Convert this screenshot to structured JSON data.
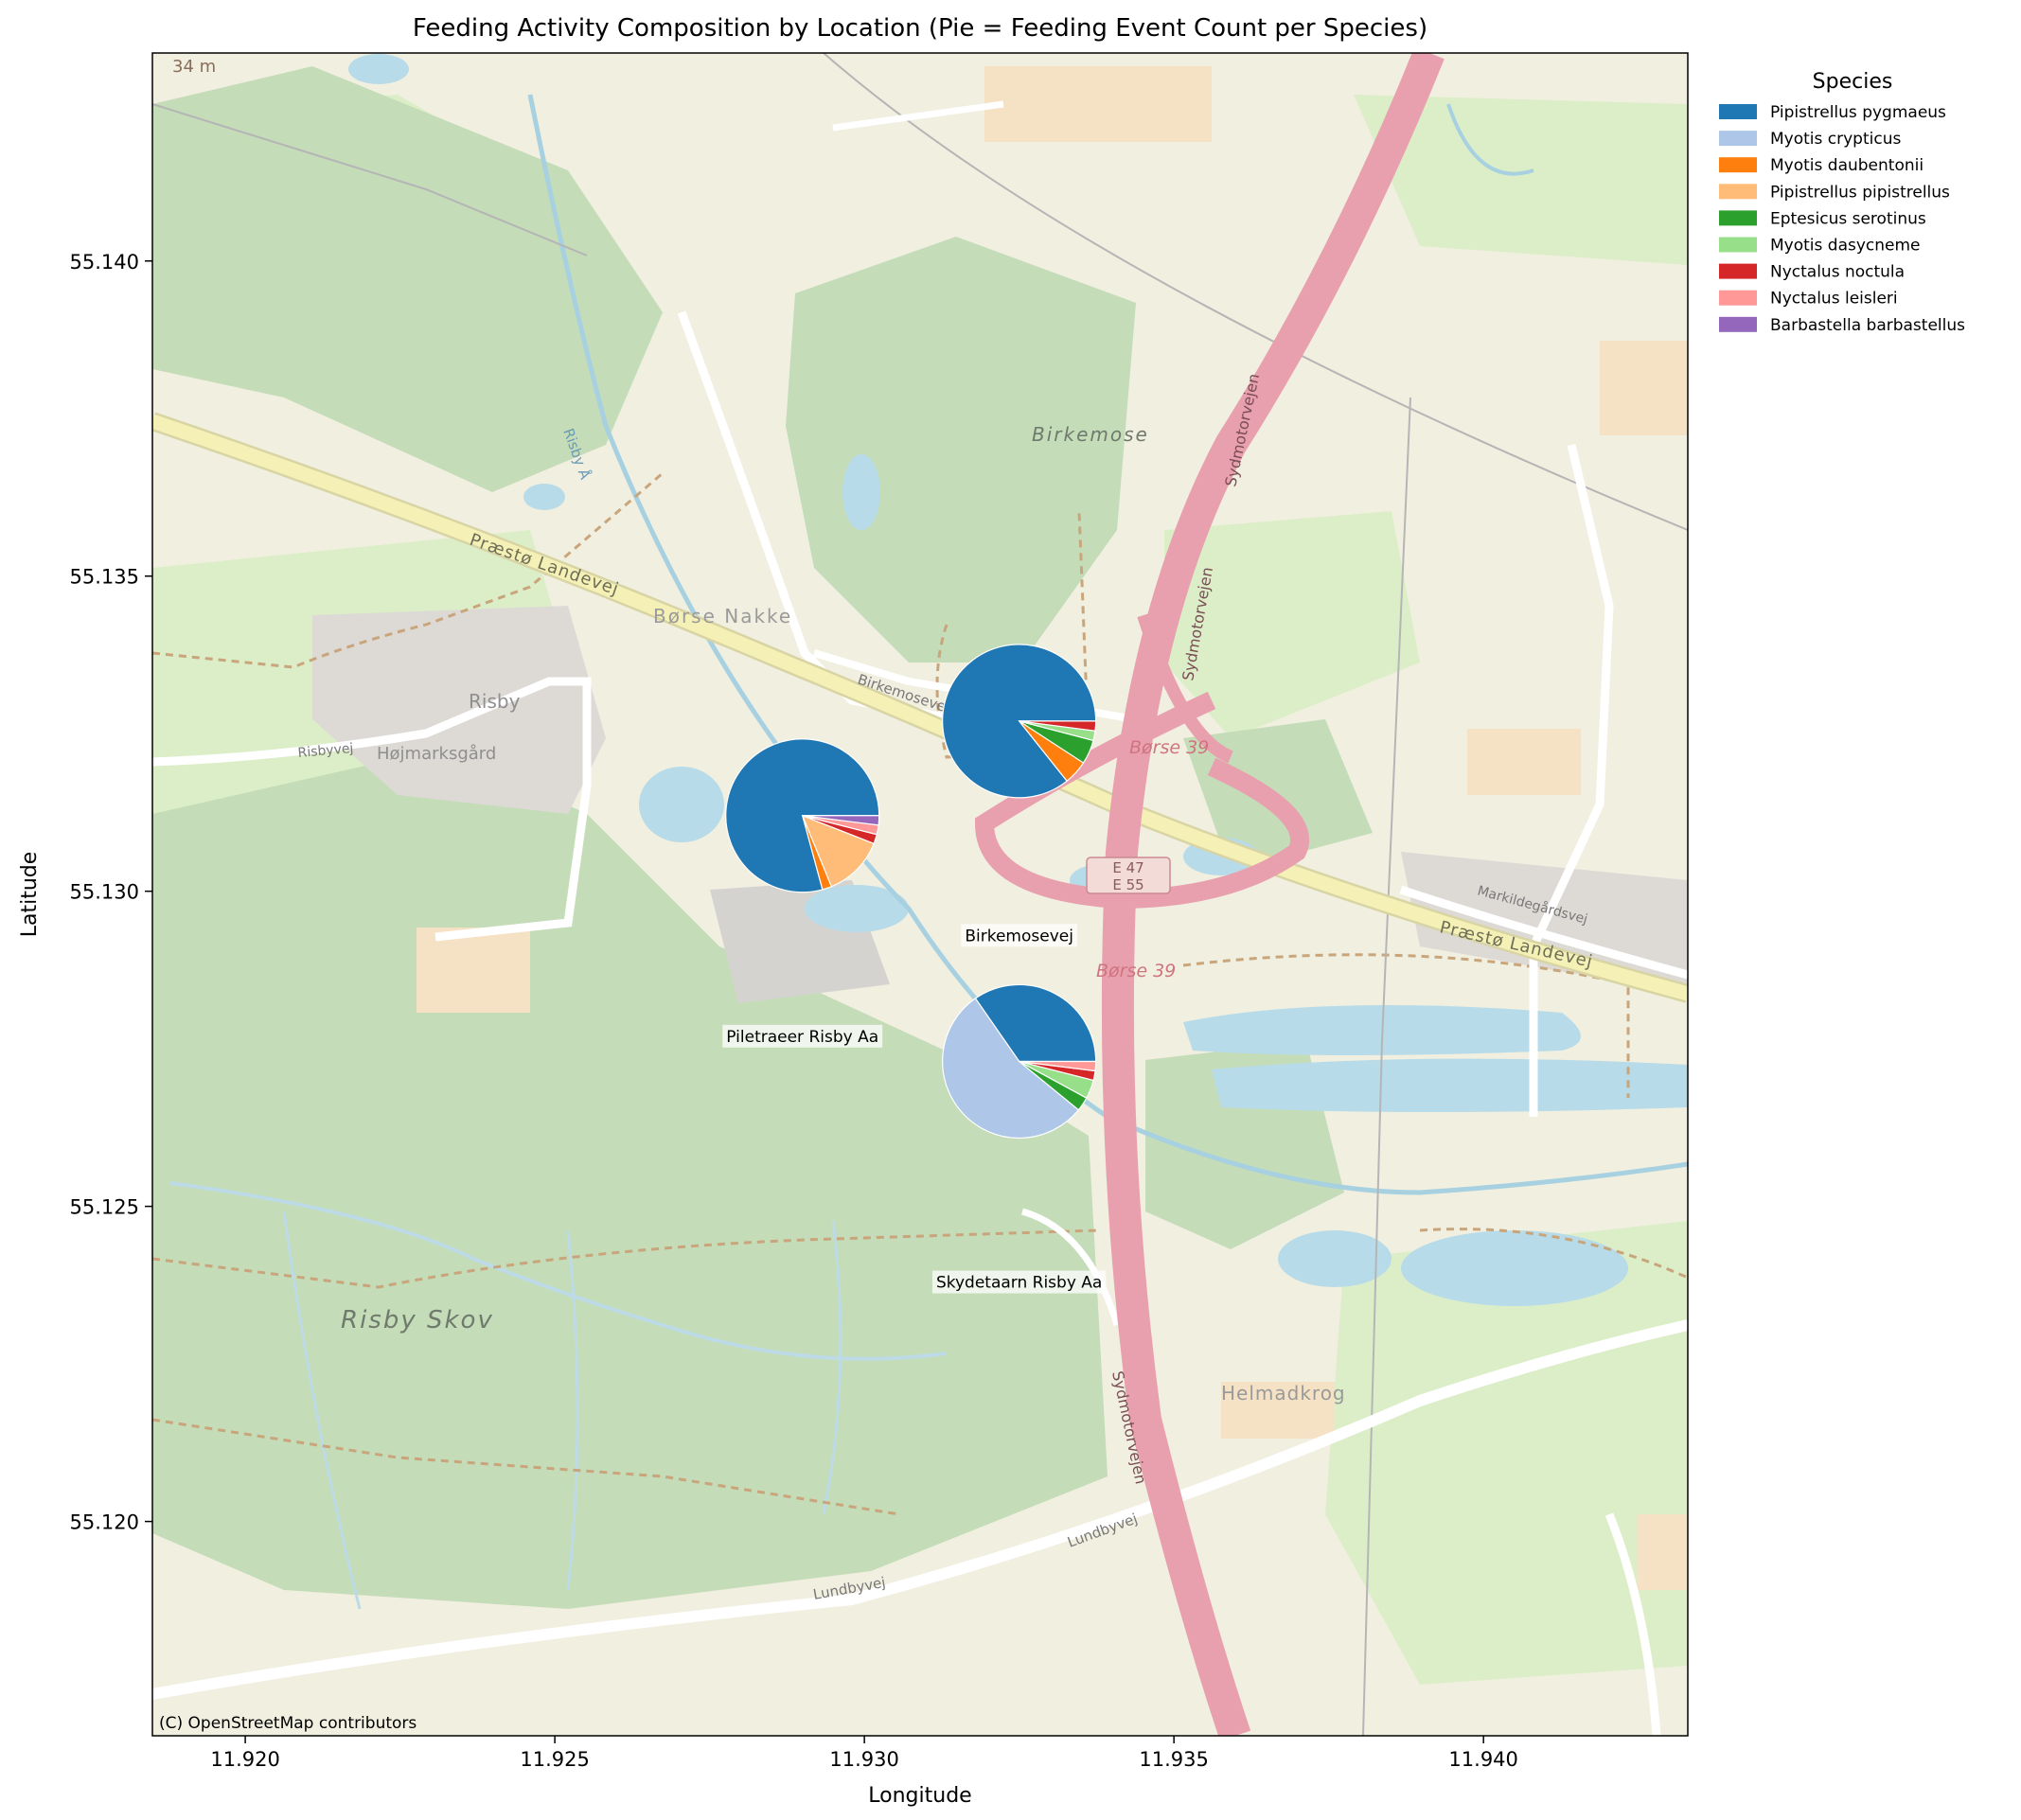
{
  "title": "Feeding Activity Composition by Location (Pie = Feeding Event Count per Species)",
  "xlabel": "Longitude",
  "ylabel": "Latitude",
  "attribution": "(C) OpenStreetMap contributors",
  "legend": {
    "title": "Species",
    "placement": "outside-right",
    "items": [
      {
        "label": "Pipistrellus pygmaeus",
        "color": "#1f77b4"
      },
      {
        "label": "Myotis crypticus",
        "color": "#aec7e8"
      },
      {
        "label": "Myotis daubentonii",
        "color": "#ff7f0e"
      },
      {
        "label": "Pipistrellus pipistrellus",
        "color": "#ffbb78"
      },
      {
        "label": "Eptesicus serotinus",
        "color": "#2ca02c"
      },
      {
        "label": "Myotis dasycneme",
        "color": "#98df8a"
      },
      {
        "label": "Nyctalus noctula",
        "color": "#d62728"
      },
      {
        "label": "Nyctalus leisleri",
        "color": "#ff9896"
      },
      {
        "label": "Barbastella barbastellus",
        "color": "#9467bd"
      }
    ]
  },
  "basemap": {
    "place_labels": [
      "Birkemose",
      "Børse Nakke",
      "Risby",
      "Højmarksgård",
      "Risby Skov",
      "Helmadkrog",
      "Præstø Landevej",
      "Præstø Landevej",
      "Sydmotorvejen",
      "Sydmotorvejen",
      "Sydmotorvejen",
      "Lundbyvej",
      "Lundbyvej",
      "Birkemosevej",
      "Markildegårdsvej",
      "Børse 39",
      "Børse 39",
      "E 47",
      "E 55",
      "34 m",
      "Risbyvej",
      "Risby Å"
    ],
    "colors": {
      "background": "#f1efe0",
      "forest": "#c4dcb8",
      "meadow": "#dceec8",
      "water": "#b7dbe8",
      "motorway": "#e8a0ae",
      "trunk": "#f5f1b6",
      "residential": "#dddad6",
      "farmyard": "#f5e1c4"
    }
  },
  "chart_data": {
    "type": "scatter-pie",
    "xlabel": "Longitude",
    "ylabel": "Latitude",
    "xlim": [
      11.9185,
      11.9433
    ],
    "ylim": [
      55.1166,
      55.1433
    ],
    "xticks": [
      "11.920",
      "11.925",
      "11.930",
      "11.935",
      "11.940"
    ],
    "yticks": [
      "55.120",
      "55.125",
      "55.130",
      "55.135",
      "55.140"
    ],
    "xtick_values": [
      11.92,
      11.925,
      11.93,
      11.935,
      11.94
    ],
    "ytick_values": [
      55.12,
      55.125,
      55.13,
      55.135,
      55.14
    ],
    "grid": false,
    "species": [
      "Pipistrellus pygmaeus",
      "Myotis crypticus",
      "Myotis daubentonii",
      "Pipistrellus pipistrellus",
      "Eptesicus serotinus",
      "Myotis dasycneme",
      "Nyctalus noctula",
      "Nyctalus leisleri",
      "Barbastella barbastellus"
    ],
    "locations": [
      {
        "name": "Birkemosevej",
        "lon": 11.9325,
        "lat": 55.1327,
        "label_lon": 11.9325,
        "label_lat": 55.1293,
        "values": [
          84,
          0,
          5,
          0,
          5,
          2,
          2,
          0,
          0
        ]
      },
      {
        "name": "Piletraeer Risby Aa",
        "lon": 11.929,
        "lat": 55.1312,
        "label_lon": 11.929,
        "label_lat": 55.1277,
        "values": [
          80,
          0,
          2,
          13,
          0,
          0,
          2,
          2,
          2
        ]
      },
      {
        "name": "Skydetaarn Risby Aa",
        "lon": 11.9325,
        "lat": 55.1273,
        "label_lon": 11.9325,
        "label_lat": 55.1238,
        "values": [
          35,
          55,
          0,
          0,
          3,
          4,
          2,
          2,
          0
        ]
      }
    ]
  }
}
